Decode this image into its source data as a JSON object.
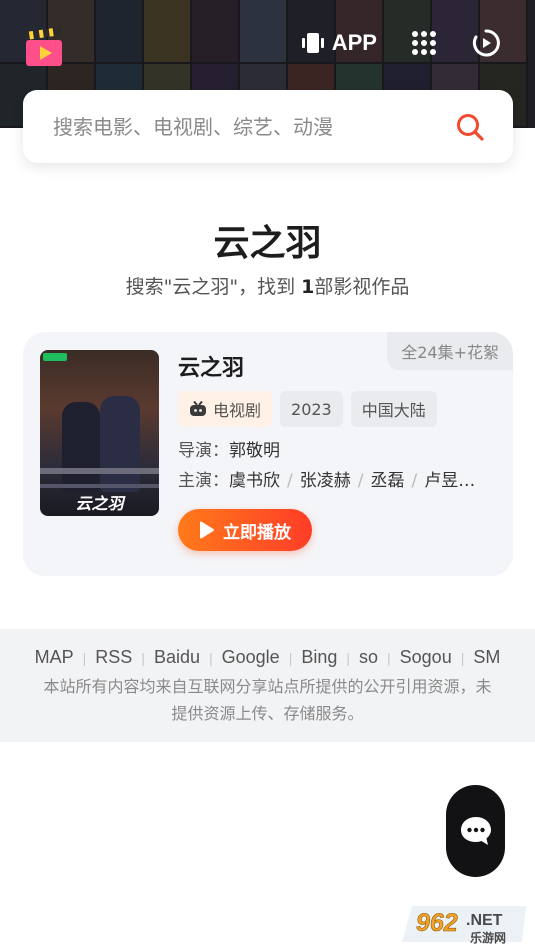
{
  "header": {
    "app_label": "APP",
    "logo_icon": "clapperboard-play-icon",
    "grid_icon": "grid-dots-icon",
    "history_icon": "play-history-icon"
  },
  "search": {
    "placeholder": "搜索电影、电视剧、综艺、动漫",
    "value": "",
    "icon": "search-icon",
    "accent": "#f04a2f"
  },
  "result": {
    "query_title": "云之羽",
    "count_prefix": "搜索\"云之羽\"，找到 ",
    "count_number": "1",
    "count_suffix": "部影视作品"
  },
  "card": {
    "episode_badge": "全24集+花絮",
    "title": "云之羽",
    "poster_title": "云之羽",
    "tags": {
      "type": "电视剧",
      "year": "2023",
      "region": "中国大陆"
    },
    "director_label": "导演：",
    "director": "郭敬明",
    "cast_label": "主演：",
    "cast": [
      "虞书欣",
      "张凌赫",
      "丞磊",
      "卢昱…"
    ],
    "play_label": "立即播放",
    "play_gradient": [
      "#ff7a1a",
      "#ff3d28"
    ]
  },
  "footer": {
    "links": [
      "MAP",
      "RSS",
      "Baidu",
      "Google",
      "Bing",
      "so",
      "Sogou",
      "SM"
    ],
    "note": "本站所有内容均来自互联网分享站点所提供的公开引用资源，未提供资源上传、存储服务。"
  },
  "watermark": {
    "brand": "962.NET",
    "sub": "乐游网"
  }
}
